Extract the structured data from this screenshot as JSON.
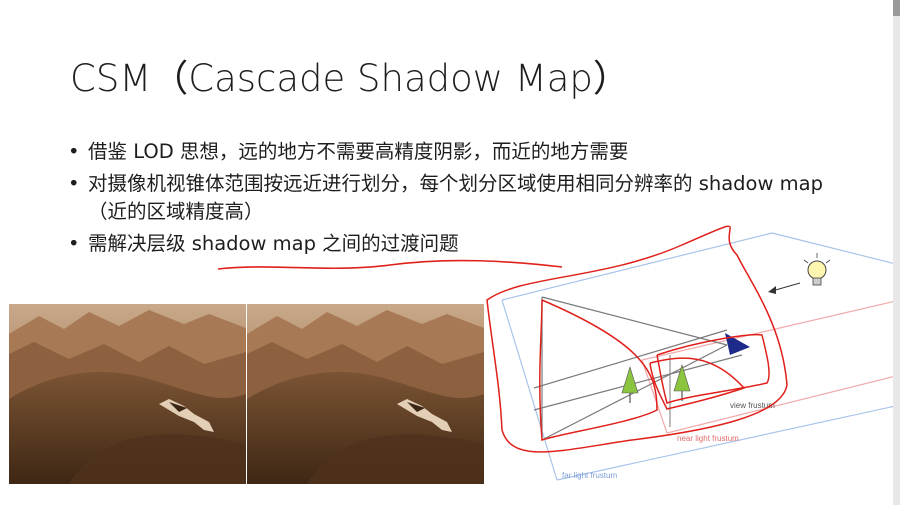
{
  "slide": {
    "title": "CSM（Cascade Shadow Map）",
    "bullets": [
      "借鉴 LOD 思想，远的地方不需要高精度阴影，而近的地方需要",
      "对摄像机视锥体范围按远近进行划分，每个划分区域使用相同分辨率的 shadow map（近的区域精度高）",
      "需解决层级 shadow map 之间的过渡问题"
    ],
    "bullet_glyph": "•"
  },
  "diagram": {
    "labels": {
      "view_frustum": "view frustum",
      "near_light_frustum": "near light frustum",
      "far_light_frustum": "far light frustum"
    },
    "icons": [
      "light-bulb-icon",
      "light-direction-arrow-icon",
      "tree-icon"
    ]
  },
  "colors": {
    "annotation_red": "#e0201b",
    "far_frustum_blue": "#a9c4ea",
    "near_frustum_pink": "#f2a9a9",
    "view_frustum_gray": "#7a7a7a",
    "camera_blue": "#1d2a8a",
    "tree_green": "#8bc43f"
  }
}
